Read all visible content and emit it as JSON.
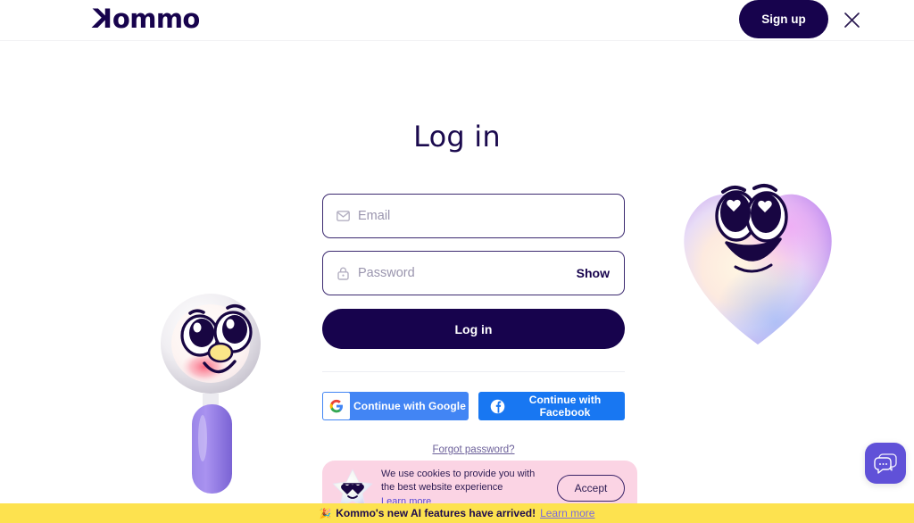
{
  "brand": {
    "name": "Kommo",
    "primary_color": "#17034d",
    "accent_purple": "#6051d8"
  },
  "header": {
    "logo_text": "ommo",
    "logo_mark": "K",
    "signup_label": "Sign up",
    "close_icon": "close-icon"
  },
  "main": {
    "title": "Log in",
    "email": {
      "placeholder": "Email",
      "value": "",
      "icon": "envelope-icon"
    },
    "password": {
      "placeholder": "Password",
      "value": "",
      "icon": "lock-icon",
      "show_label": "Show"
    },
    "login_button": "Log in",
    "social": [
      {
        "label": "Continue with Google",
        "provider": "google",
        "color": "#4285f4",
        "icon": "google-icon"
      },
      {
        "label": "Continue with Facebook",
        "provider": "facebook",
        "color": "#1877f2",
        "icon": "facebook-icon"
      }
    ],
    "forgot_password": "Forgot password?"
  },
  "mascots": {
    "magnifier": "magnifying-glass-mascot",
    "heart": "heart-mascot"
  },
  "cookie_banner": {
    "icon": "star-mascot",
    "message": "We use cookies to provide you with the best website experience",
    "learn_more": "Learn more",
    "accept_label": "Accept",
    "background_color": "#fbd4e4"
  },
  "ai_banner": {
    "emoji": "🎉",
    "text": "Kommo's new AI features have arrived!",
    "link": "Learn more",
    "background_color": "#fde24f"
  },
  "chat_widget": {
    "icon": "chat-bubbles-icon",
    "color": "#6051d8"
  }
}
